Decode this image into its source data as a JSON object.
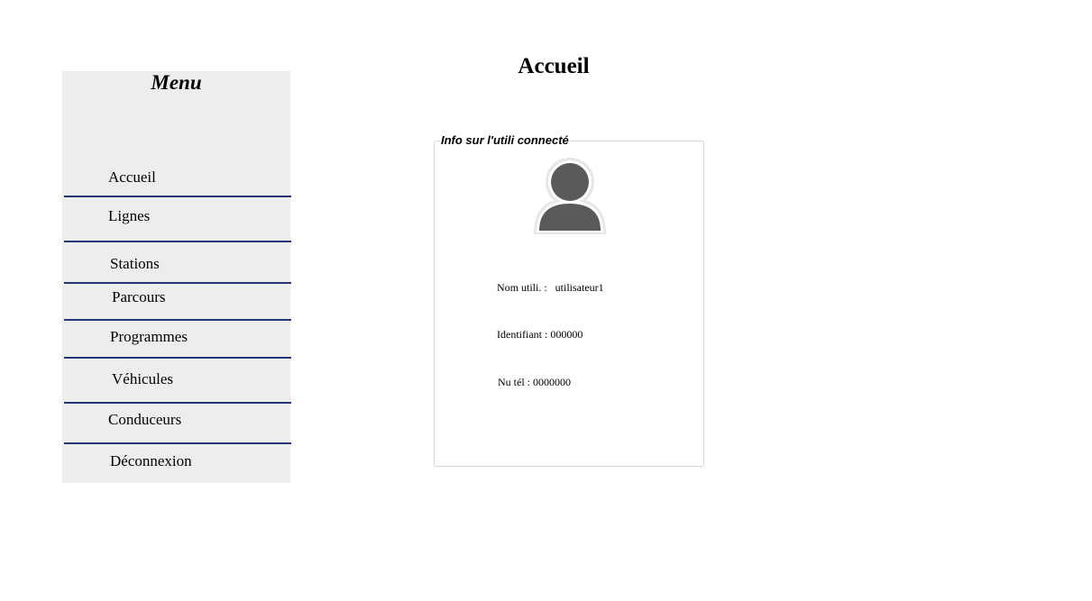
{
  "page": {
    "title": "Accueil"
  },
  "menu": {
    "title": "Menu",
    "items": [
      {
        "label": "Accueil"
      },
      {
        "label": "Lignes"
      },
      {
        "label": "Stations"
      },
      {
        "label": "Parcours"
      },
      {
        "label": "Programmes"
      },
      {
        "label": "Véhicules"
      },
      {
        "label": "Conduceurs"
      },
      {
        "label": "Déconnexion"
      }
    ]
  },
  "user_card": {
    "legend": "Info sur l'utili connecté",
    "avatar_icon": "user-avatar-icon",
    "name_label": "Nom utili. :",
    "name_value": "utilisateur1",
    "id_line": "Identifiant : 000000",
    "phone_line": "Nu tél : 0000000"
  },
  "colors": {
    "menu_background": "#ededed",
    "menu_divider": "#26347a",
    "avatar": "#5a5a5a",
    "card_border": "#d3d3d3"
  }
}
